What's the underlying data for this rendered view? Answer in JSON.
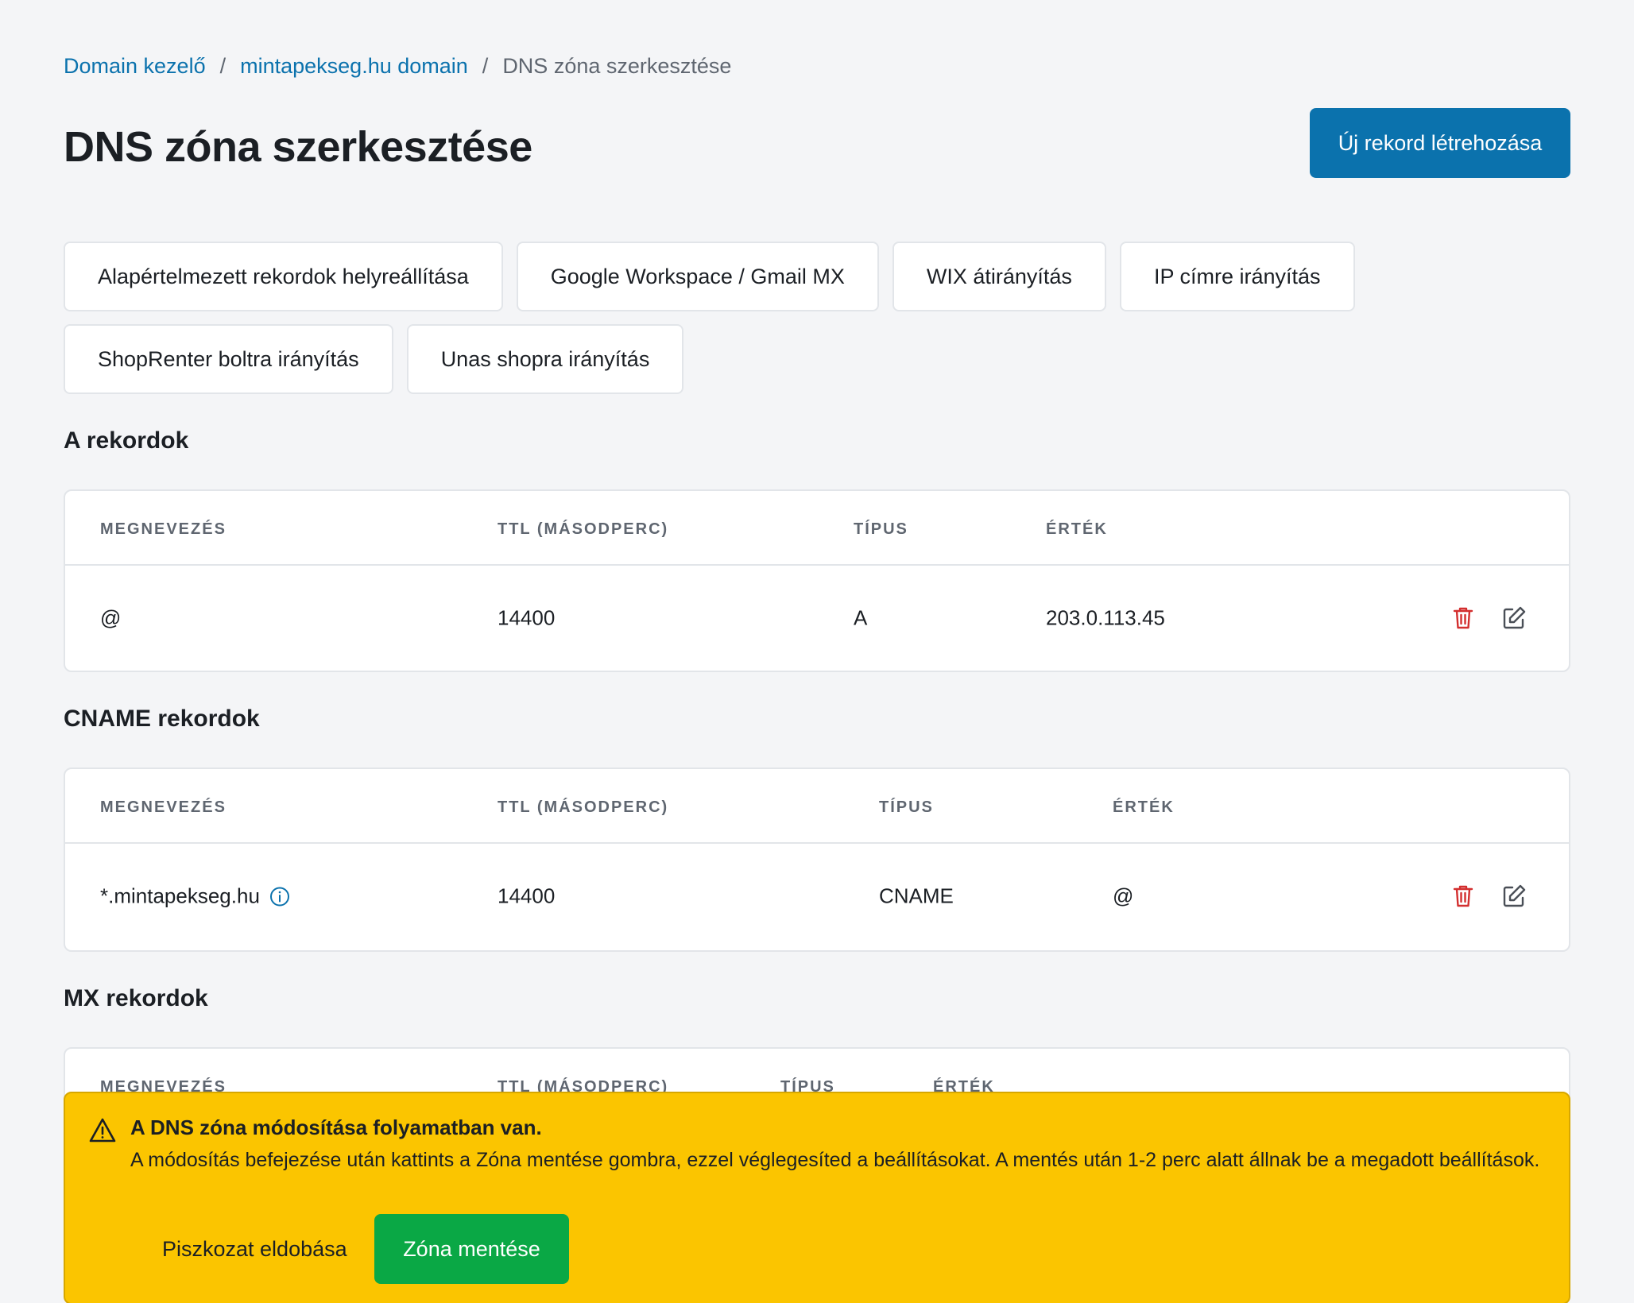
{
  "breadcrumb": {
    "item1": "Domain kezelő",
    "item2": "mintapekseg.hu domain",
    "current": "DNS zóna szerkesztése",
    "separator": "/"
  },
  "page_title": "DNS zóna szerkesztése",
  "new_record_button": "Új rekord létrehozása",
  "presets": [
    "Alapértelmezett rekordok helyreállítása",
    "Google Workspace / Gmail MX",
    "WIX átirányítás",
    "IP címre irányítás",
    "ShopRenter boltra irányítás",
    "Unas shopra irányítás"
  ],
  "columns": {
    "name": "MEGNEVEZÉS",
    "ttl": "TTL (MÁSODPERC)",
    "type": "TÍPUS",
    "value": "ÉRTÉK"
  },
  "sections": {
    "a": {
      "title": "A rekordok",
      "rows": [
        {
          "name": "@",
          "ttl": "14400",
          "type": "A",
          "value": "203.0.113.45"
        }
      ]
    },
    "cname": {
      "title": "CNAME rekordok",
      "rows": [
        {
          "name": "*.mintapekseg.hu",
          "ttl": "14400",
          "type": "CNAME",
          "value": "@",
          "info_icon": "info-icon"
        }
      ]
    },
    "mx": {
      "title": "MX rekordok",
      "rows": []
    }
  },
  "banner": {
    "title": "A DNS zóna módosítása folyamatban van.",
    "text": "A módosítás befejezése után kattints a Zóna mentése gombra, ezzel véglegesíted a beállításokat. A mentés után 1-2 perc alatt állnak be a megadott beállítások.",
    "discard_label": "Piszkozat eldobása",
    "save_label": "Zóna mentése"
  },
  "colors": {
    "primary": "#0b72ad",
    "banner_bg": "#fbc500",
    "save_green": "#0aa845",
    "delete_red": "#d32f2f"
  }
}
